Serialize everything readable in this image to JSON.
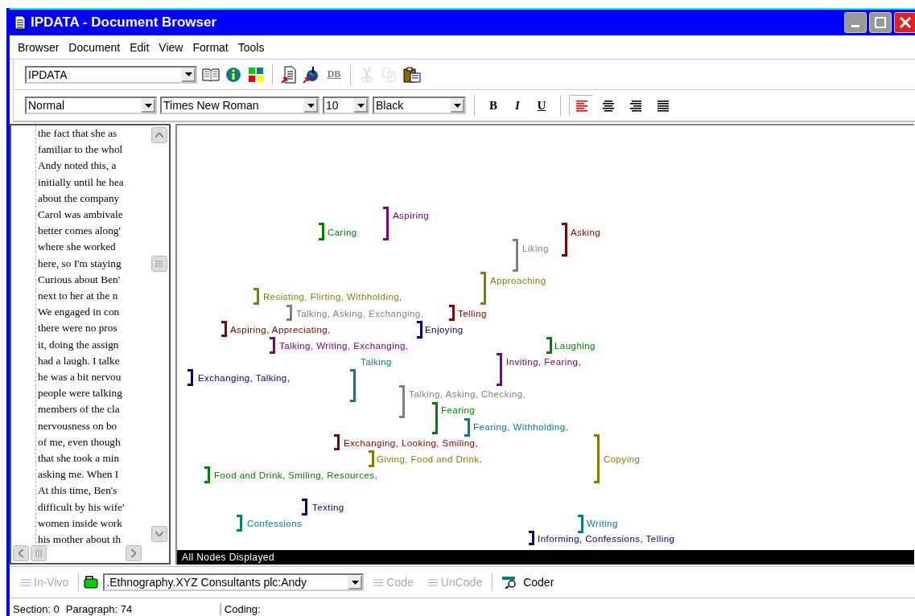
{
  "window": {
    "title": "IPDATA - Document Browser"
  },
  "menu": [
    {
      "label": "Browser"
    },
    {
      "label": "Document"
    },
    {
      "label": "Edit"
    },
    {
      "label": "View"
    },
    {
      "label": "Format"
    },
    {
      "label": "Tools"
    }
  ],
  "toolbar": {
    "database": "IPDATA",
    "buttons": [
      {
        "kind": "book",
        "disabled": false
      },
      {
        "kind": "info",
        "disabled": false
      },
      {
        "kind": "grid",
        "disabled": false
      },
      {
        "kind": "sep"
      },
      {
        "kind": "doc",
        "disabled": false
      },
      {
        "kind": "pin",
        "disabled": false
      },
      {
        "kind": "text",
        "label": "DB",
        "disabled": true
      },
      {
        "kind": "sep"
      },
      {
        "kind": "cut",
        "disabled": true
      },
      {
        "kind": "copy",
        "disabled": true
      },
      {
        "kind": "paste",
        "disabled": false
      }
    ]
  },
  "format_bar": {
    "style": "Normal",
    "font": "Times New Roman",
    "size": "10",
    "color_name": "Black",
    "styles": [
      {
        "kind": "bold",
        "label": "B"
      },
      {
        "kind": "italic",
        "label": "I"
      },
      {
        "kind": "underline",
        "label": "U"
      }
    ],
    "alignment": [
      {
        "kind": "left",
        "selected": true
      },
      {
        "kind": "center",
        "selected": false
      },
      {
        "kind": "right",
        "selected": false
      },
      {
        "kind": "justify",
        "selected": false
      }
    ]
  },
  "document": {
    "lines": [
      "the fact that she as",
      "familiar to the whol",
      "Andy noted this, a",
      "initially until he hea",
      "about the company",
      "Carol was ambivale",
      "better comes along'",
      "where she worked",
      "here, so I'm staying",
      "Curious about Ben'",
      "next to her at the n",
      "We engaged in con",
      "there were no pros",
      "it, doing the assign",
      "had a laugh.  I talke",
      "he was a bit nervou",
      "people were talking",
      "members of the cla",
      "nervousness on bo",
      "of me, even though",
      "that she took a min",
      "asking me. When I",
      "At this time, Ben's",
      "difficult by his wife'",
      "women inside work",
      "his mother about th"
    ]
  },
  "canvas": {
    "status": "All Nodes Displayed",
    "nodes": [
      {
        "label": "Aspiring",
        "color": "#800080"
      },
      {
        "label": "Caring",
        "color": "#008000"
      },
      {
        "label": "Asking",
        "color": "#800000"
      },
      {
        "label": "Liking",
        "color": "#808080"
      },
      {
        "label": "Approaching",
        "color": "#808000"
      },
      {
        "label": "Resisting, Flirting, Withholding,",
        "color": "#808000"
      },
      {
        "label": "Talking, Asking, Exchanging,",
        "color": "#808080"
      },
      {
        "label": "Telling",
        "color": "#800000"
      },
      {
        "label": "Aspiring, Appreciating,",
        "color": "#800000"
      },
      {
        "label": "Enjoying",
        "color": "#000080"
      },
      {
        "label": "Talking, Writing, Exchanging,",
        "color": "#800080"
      },
      {
        "label": "Laughing",
        "color": "#008000"
      },
      {
        "label": "Talking",
        "color": "#008080"
      },
      {
        "label": "Inviting, Fearing,",
        "color": "#800080"
      },
      {
        "label": "Exchanging, Talking,",
        "color": "#000080"
      },
      {
        "label": "Talking, Asking, Checking,",
        "color": "#808080"
      },
      {
        "label": "Fearing",
        "color": "#008000"
      },
      {
        "label": "Fearing, Withholding,",
        "color": "#008080"
      },
      {
        "label": "Exchanging, Looking, Smiling,",
        "color": "#800000"
      },
      {
        "label": "Copying",
        "color": "#808000"
      },
      {
        "label": "Giving, Food and Drink,",
        "color": "#808000"
      },
      {
        "label": "Food and Drink, Smiling, Resources,",
        "color": "#008000"
      },
      {
        "label": "Texting",
        "color": "#000080"
      },
      {
        "label": "Confessions",
        "color": "#008080"
      },
      {
        "label": "Writing",
        "color": "#008080"
      },
      {
        "label": "Informing, Confessions, Telling",
        "color": "#000080"
      }
    ]
  },
  "coding_bar": {
    "invivo": {
      "label": "In-Vivo",
      "disabled": true
    },
    "project": ".Ethnography.XYZ Consultants plc:Andy",
    "code": {
      "label": "Code",
      "disabled": true
    },
    "uncode": {
      "label": "UnCode",
      "disabled": true
    },
    "coder": {
      "label": "Coder",
      "disabled": false
    }
  },
  "status_bar": {
    "section": "Section: 0",
    "paragraph": "Paragraph: 74",
    "coding": "Coding:"
  }
}
